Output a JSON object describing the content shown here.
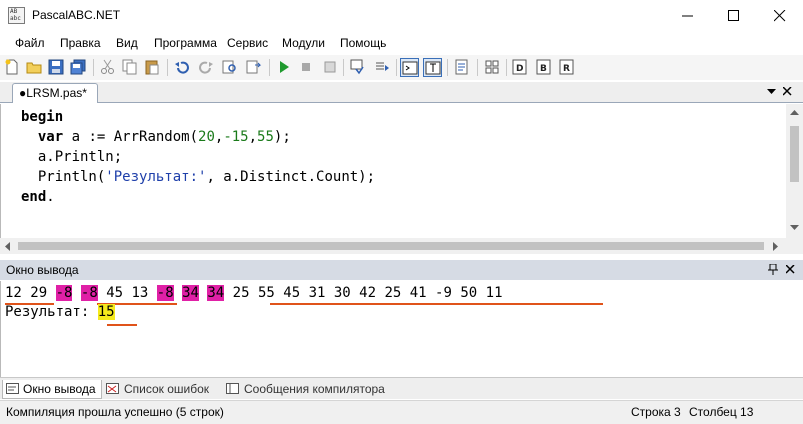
{
  "window": {
    "title": "PascalABC.NET",
    "icon_text": "AB abc"
  },
  "menu": [
    "Файл",
    "Правка",
    "Вид",
    "Программа",
    "Сервис",
    "Модули",
    "Помощь"
  ],
  "toolbar_icons": [
    "new-file-icon",
    "open-folder-icon",
    "save-icon",
    "save-all-icon",
    "cut-icon",
    "copy-icon",
    "paste-icon",
    "undo-icon",
    "redo-icon",
    "find-icon",
    "replace-icon",
    "run-icon",
    "stop-icon",
    "debug-icon",
    "step-icon",
    "console-icon",
    "text-icon",
    "format-icon",
    "properties-icon",
    "compile-icon",
    "build-icon",
    "rebuild-icon"
  ],
  "tab": {
    "label": "●LRSM.pas*"
  },
  "code": {
    "line1": {
      "kw": "begin"
    },
    "line2": {
      "kw": "var",
      "a": " a := ArrRandom(",
      "n1": "20",
      "c1": ",",
      "n2": "-15",
      "c2": ",",
      "n3": "55",
      "end": ");"
    },
    "line3": {
      "text": "a.Println;"
    },
    "line4": {
      "pre": "Println(",
      "str": "'Результат:'",
      "post": ", a.Distinct.Count);"
    },
    "line5": {
      "kw": "end",
      "dot": "."
    }
  },
  "output_panel": {
    "title": "Окно вывода",
    "numbers": [
      "12",
      "29",
      "-8",
      "-8",
      "45",
      "13",
      "-8",
      "34",
      "34",
      "25",
      "55",
      "45",
      "31",
      "30",
      "42",
      "25",
      "41",
      "-9",
      "50",
      "11"
    ],
    "result_label": "Результат: ",
    "result_value": "15"
  },
  "bottom_tabs": [
    "Окно вывода",
    "Список ошибок",
    "Сообщения компилятора"
  ],
  "status": {
    "message": "Компиляция прошла успешно (5 строк)",
    "row": "Строка  3",
    "col": "Столбец  13"
  },
  "colors": {
    "highlight_duplicate": "#e020a6",
    "highlight_result": "#f5ea1c",
    "underline": "#e0531a",
    "keyword": "#000000",
    "number": "#1a7a1a",
    "string": "#1e3faa"
  }
}
